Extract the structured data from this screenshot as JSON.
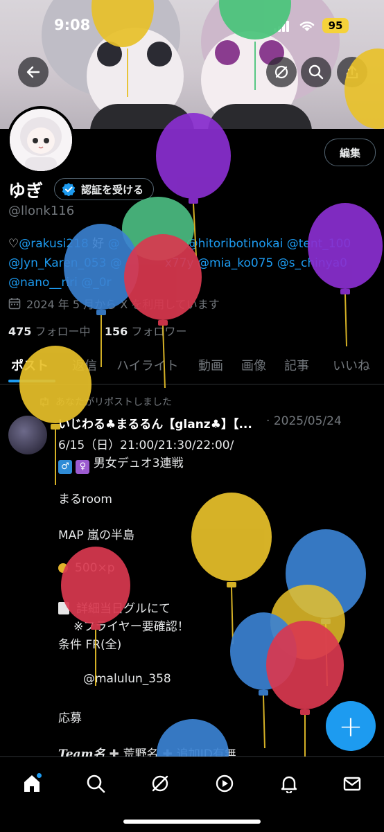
{
  "status_bar": {
    "time": "9:08",
    "battery": "95"
  },
  "profile": {
    "name": "ゆぎ",
    "verify_label": "認証を受ける",
    "handle": "@llonk116",
    "edit_label": "編集",
    "bio_prefix": "♡",
    "bio_mention_1": "@rakusi218",
    "bio_text_1": " 好 ",
    "bio_mention_2": "@",
    "bio_mention_3": "@hitoribotinokai",
    "bio_mention_4": "@tent_100",
    "bio_mention_5": "@Jyn_Karen_053",
    "bio_mention_6": "@",
    "bio_mention_6b": "x77y",
    "bio_mention_7": "@mia_ko075",
    "bio_mention_8": "@s_chinya0",
    "bio_mention_9": "@nano__riri",
    "bio_mention_10": "@_0r",
    "joined": "2024 年 5 月から X を利用しています",
    "following_count": "475",
    "following_label": "フォロー中",
    "followers_count": "156",
    "followers_label": "フォロワー"
  },
  "tabs": [
    "ポスト",
    "返信",
    "ハイライト",
    "動画",
    "画像",
    "記事",
    "いいね"
  ],
  "post": {
    "repost_label": "あなたがリポストしました",
    "author": "いじわる♣まるるん【glanz♣】【...",
    "separator": "·",
    "date": "2025/05/24",
    "lines": [
      "6/15（日）21:00/21:30/22:00/",
      "男女デュオ3連戦",
      "まるroom",
      "MAP  嵐の半島",
      "500×p",
      "詳細当日グルにて",
      "※フライヤー要確認！",
      "条件  FR(全)",
      "@malulun_358",
      "応募",
      "Team名",
      "荒野名",
      "追加ID有無"
    ]
  },
  "fab_label": "+",
  "nav": {
    "items": [
      "home-icon",
      "search-icon",
      "grok-icon",
      "video-icon",
      "notifications-icon",
      "messages-icon"
    ]
  },
  "colors": {
    "accent": "#1d9bf0",
    "background": "#000000",
    "muted": "#71767b",
    "battery": "#f5d23a"
  }
}
